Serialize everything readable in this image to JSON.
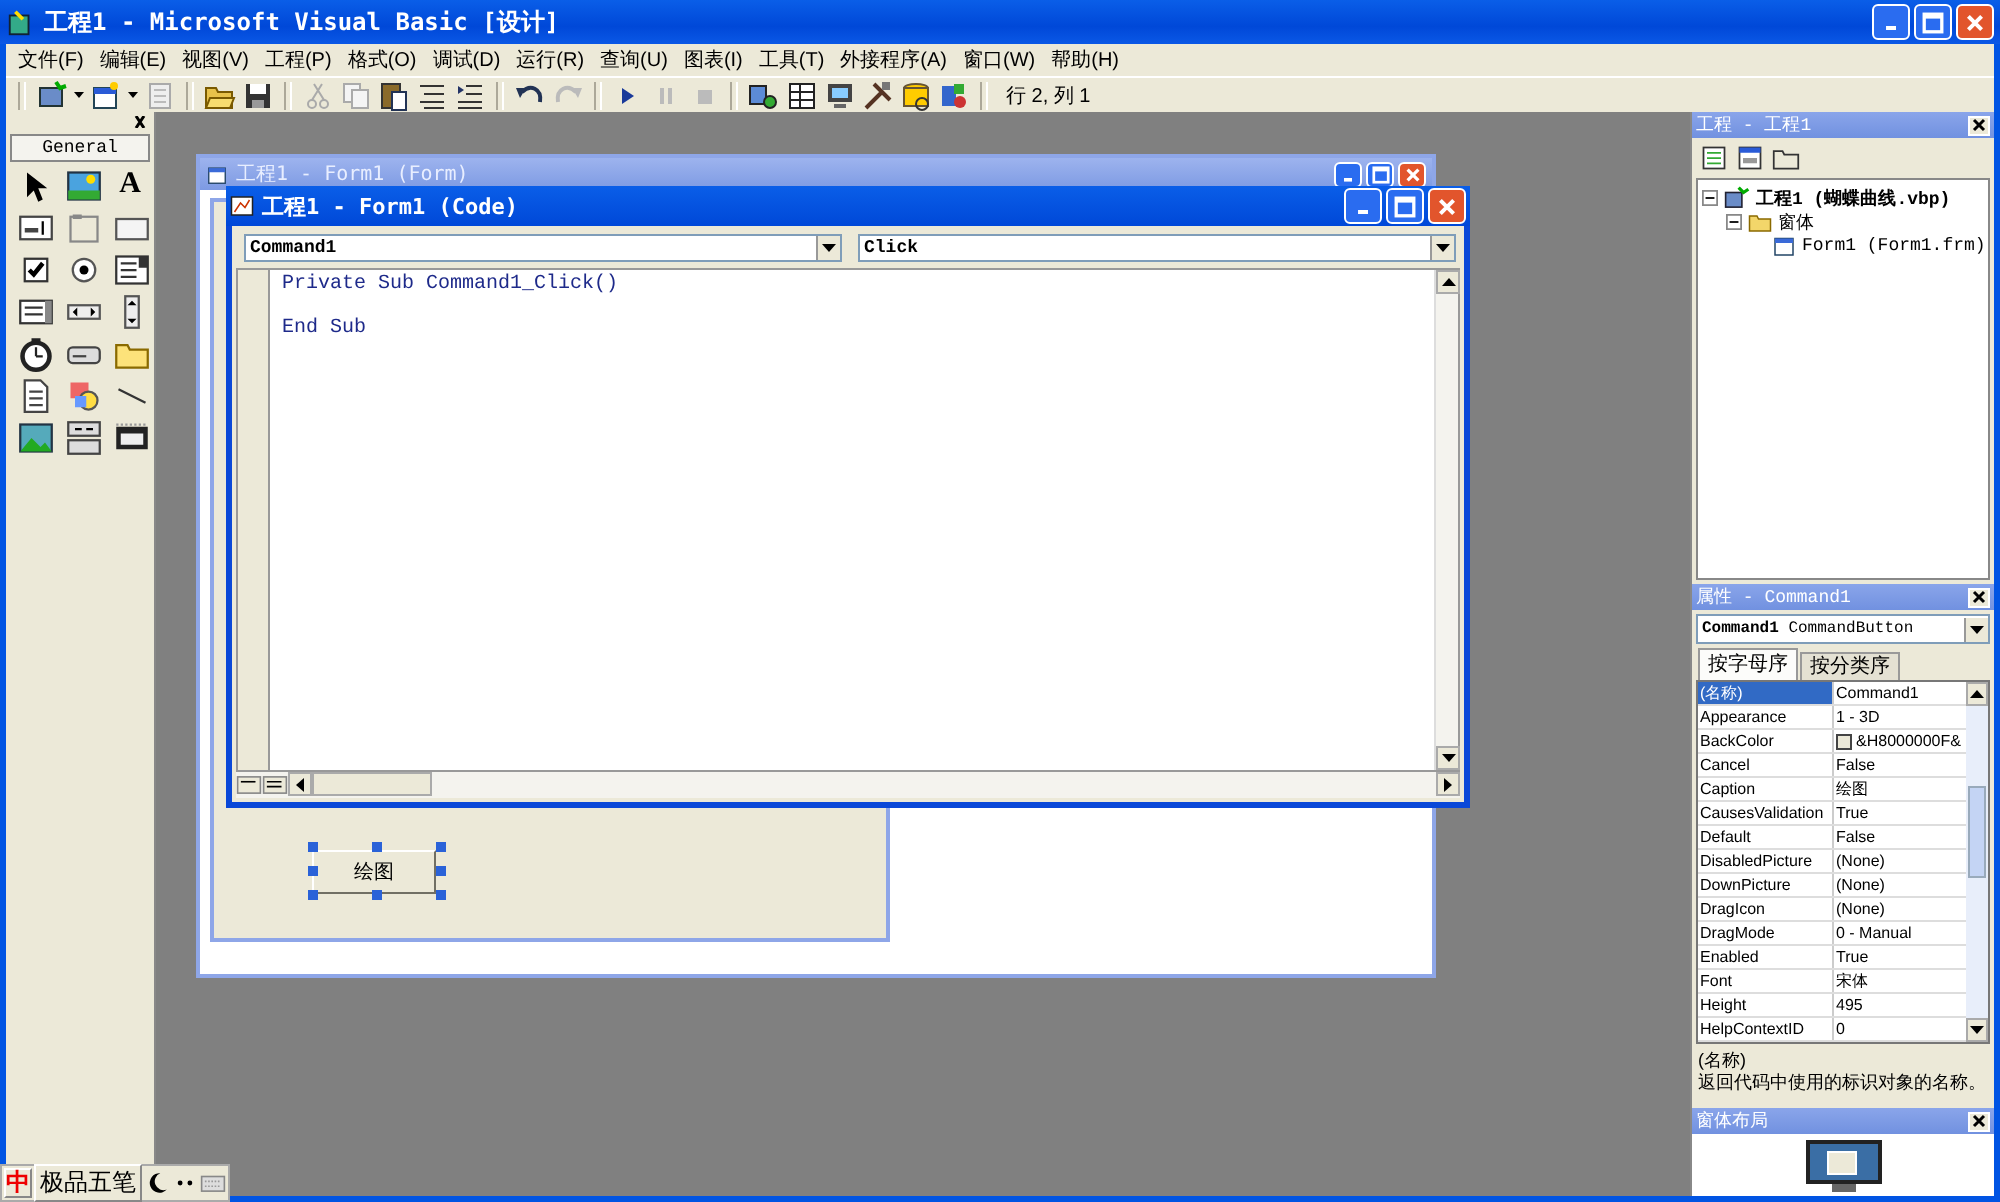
{
  "window": {
    "title": "工程1 - Microsoft Visual Basic [设计]"
  },
  "menu": [
    {
      "label": "文件(F)"
    },
    {
      "label": "编辑(E)"
    },
    {
      "label": "视图(V)"
    },
    {
      "label": "工程(P)"
    },
    {
      "label": "格式(O)"
    },
    {
      "label": "调试(D)"
    },
    {
      "label": "运行(R)"
    },
    {
      "label": "查询(U)"
    },
    {
      "label": "图表(I)"
    },
    {
      "label": "工具(T)"
    },
    {
      "label": "外接程序(A)"
    },
    {
      "label": "窗口(W)"
    },
    {
      "label": "帮助(H)"
    }
  ],
  "toolbar": {
    "position": "行 2, 列 1"
  },
  "toolbox": {
    "title": "General",
    "label_glyph": "A"
  },
  "form_window": {
    "title": "工程1 - Form1 (Form)",
    "button_caption": "绘图"
  },
  "code_window": {
    "title": "工程1 - Form1 (Code)",
    "object": "Command1",
    "procedure": "Click",
    "code": "Private Sub Command1_Click()\n\nEnd Sub"
  },
  "project": {
    "title": "工程 - 工程1",
    "tree": [
      {
        "label": "工程1 (蝴蝶曲线.vbp)",
        "expanded": true,
        "children": [
          {
            "label": "窗体",
            "expanded": true,
            "children": [
              {
                "label": "Form1 (Form1.frm)"
              }
            ]
          }
        ]
      }
    ]
  },
  "properties": {
    "title": "属性 - Command1",
    "object": "**Command1** CommandButton",
    "tabs": [
      {
        "label": "按字母序",
        "selected": true
      },
      {
        "label": "按分类序",
        "selected": false
      }
    ],
    "rows": [
      {
        "name": "(名称)",
        "value": "Command1",
        "kind": "text",
        "selected": true
      },
      {
        "name": "Appearance",
        "value": "1 - 3D",
        "kind": "text",
        "selected": false
      },
      {
        "name": "BackColor",
        "value": "&H8000000F&",
        "kind": "color",
        "selected": false
      },
      {
        "name": "Cancel",
        "value": "False",
        "kind": "text",
        "selected": false
      },
      {
        "name": "Caption",
        "value": "绘图",
        "kind": "text",
        "selected": false
      },
      {
        "name": "CausesValidation",
        "value": "True",
        "kind": "text",
        "selected": false
      },
      {
        "name": "Default",
        "value": "False",
        "kind": "text",
        "selected": false
      },
      {
        "name": "DisabledPicture",
        "value": "(None)",
        "kind": "text",
        "selected": false
      },
      {
        "name": "DownPicture",
        "value": "(None)",
        "kind": "text",
        "selected": false
      },
      {
        "name": "DragIcon",
        "value": "(None)",
        "kind": "text",
        "selected": false
      },
      {
        "name": "DragMode",
        "value": "0 - Manual",
        "kind": "text",
        "selected": false
      },
      {
        "name": "Enabled",
        "value": "True",
        "kind": "text",
        "selected": false
      },
      {
        "name": "Font",
        "value": "宋体",
        "kind": "text",
        "selected": false
      },
      {
        "name": "Height",
        "value": "495",
        "kind": "text",
        "selected": false
      },
      {
        "name": "HelpContextID",
        "value": "0",
        "kind": "text",
        "selected": false
      }
    ],
    "description_title": "(名称)",
    "description": "返回代码中使用的标识对象的名称。"
  },
  "form_layout": {
    "title": "窗体布局"
  },
  "ime": {
    "mode": "中",
    "name": "极品五笔"
  }
}
